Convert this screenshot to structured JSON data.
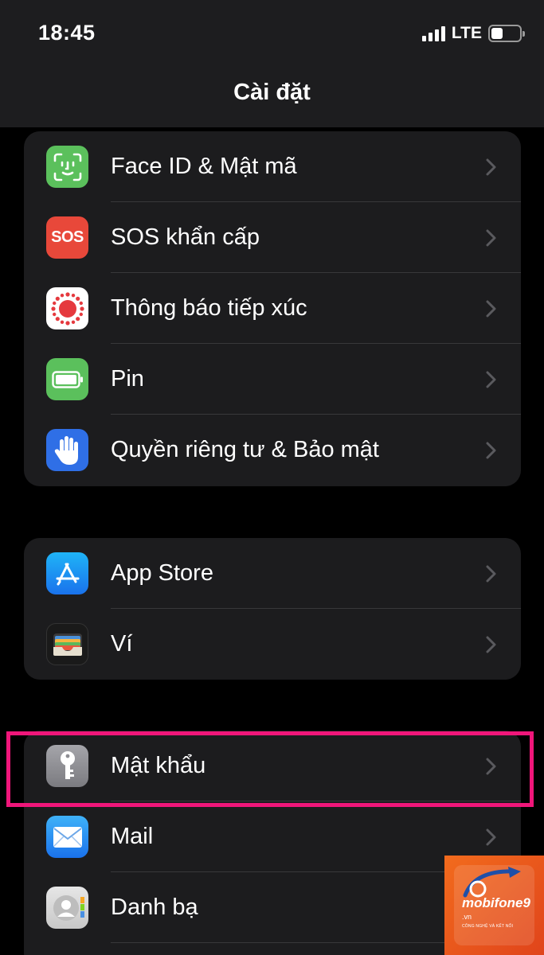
{
  "status": {
    "time": "18:45",
    "network": "LTE"
  },
  "nav": {
    "title": "Cài đặt"
  },
  "groups": [
    {
      "items": [
        {
          "label": "Face ID & Mật mã",
          "icon": "face-id-icon",
          "color": "#5bc05c"
        },
        {
          "label": "SOS khẩn cấp",
          "icon": "sos-icon",
          "color": "#e8483a"
        },
        {
          "label": "Thông báo tiếp xúc",
          "icon": "exposure-notification-icon",
          "color": "#ffffff"
        },
        {
          "label": "Pin",
          "icon": "battery-icon",
          "color": "#5bc05c"
        },
        {
          "label": "Quyền riêng tư & Bảo mật",
          "icon": "hand-icon",
          "color": "#2f6fe6"
        }
      ]
    },
    {
      "items": [
        {
          "label": "App Store",
          "icon": "app-store-icon",
          "color": "#1f8ff0"
        },
        {
          "label": "Ví",
          "icon": "wallet-icon",
          "color": "#1a1a1a"
        }
      ]
    },
    {
      "items": [
        {
          "label": "Mật khẩu",
          "icon": "key-icon",
          "color": "#8e8e93"
        },
        {
          "label": "Mail",
          "icon": "mail-icon",
          "color": "#2a8bf2"
        },
        {
          "label": "Danh bạ",
          "icon": "contacts-icon",
          "color": "#d9d9d9"
        }
      ]
    }
  ],
  "sos_icon_text": "SOS",
  "highlight_color": "#f0167a",
  "watermark": {
    "brand": "mobifone9",
    "domain": ".vn",
    "tagline": "CÔNG NGHỆ VÀ KẾT NỐI"
  }
}
